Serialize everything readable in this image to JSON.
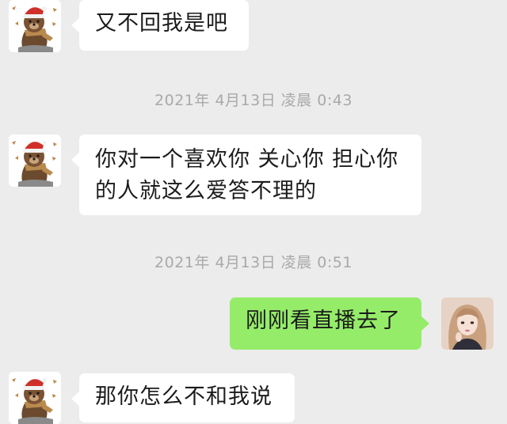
{
  "colors": {
    "background": "#ececec",
    "incoming_bubble": "#ffffff",
    "outgoing_bubble": "#95ec69",
    "timestamp_text": "#a9a9a9"
  },
  "messages": [
    {
      "type": "incoming",
      "sender_avatar": "bear-santa-hat-avatar",
      "text": "又不回我是吧"
    },
    {
      "type": "timestamp",
      "text": "2021年 4月13日 凌晨 0:43"
    },
    {
      "type": "incoming",
      "sender_avatar": "bear-santa-hat-avatar",
      "lines": [
        "你对一个喜欢你 关心你 担心你",
        "的人就这么爱答不理的"
      ]
    },
    {
      "type": "timestamp",
      "text": "2021年 4月13日 凌晨 0:51"
    },
    {
      "type": "outgoing",
      "sender_avatar": "girl-portrait-avatar",
      "text": "刚刚看直播去了"
    },
    {
      "type": "incoming",
      "sender_avatar": "bear-santa-hat-avatar",
      "text": "那你怎么不和我说"
    }
  ]
}
